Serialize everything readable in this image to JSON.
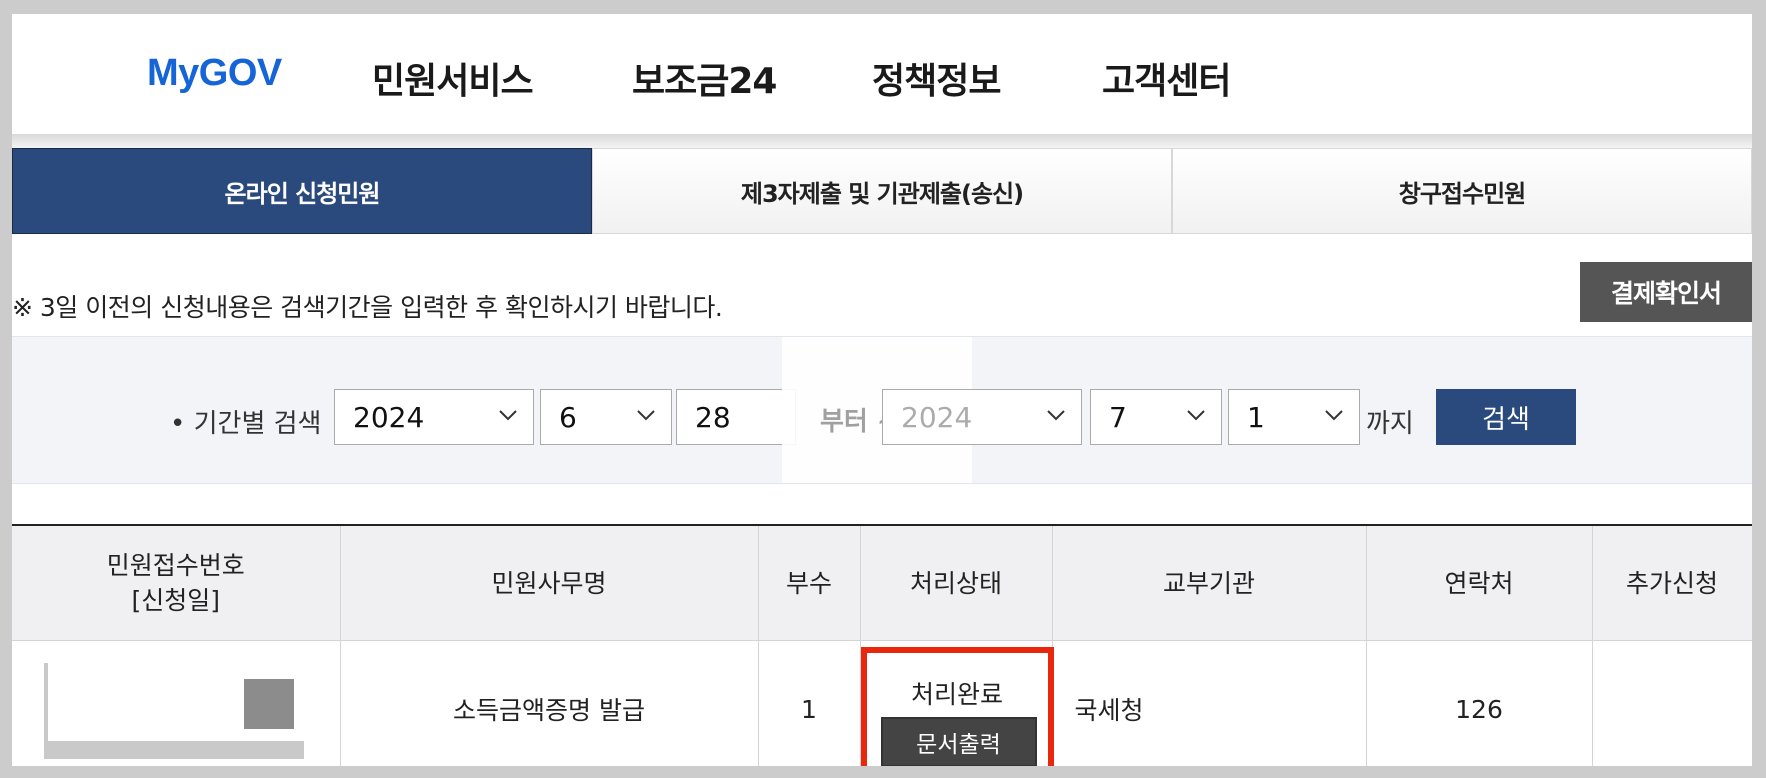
{
  "nav": {
    "logo": "MyGOV",
    "items": [
      "민원서비스",
      "보조금24",
      "정책정보",
      "고객센터"
    ]
  },
  "tabs": [
    "온라인 신청민원",
    "제3자제출 및 기관제출(송신)",
    "창구접수민원"
  ],
  "notice": "※ 3일 이전의 신청내용은 검색기간을 입력한 후 확인하시기 바랍니다.",
  "receipt_button": "결제확인서",
  "search": {
    "label": "• 기간별 검색",
    "start": {
      "year": "2024",
      "month": "6",
      "day": "28"
    },
    "from_text": "부터 ~",
    "end": {
      "year": "2024",
      "month": "7",
      "day": "1"
    },
    "until_text": "까지",
    "button": "검색"
  },
  "table": {
    "headers": [
      "민원접수번호\n[신청일]",
      "민원사무명",
      "부수",
      "처리상태",
      "교부기관",
      "연락처",
      "추가신청"
    ],
    "header_receipt_line1": "민원접수번호",
    "header_receipt_line2": "[신청일]",
    "rows": [
      {
        "service": "소득금액증명 발급",
        "copies": "1",
        "status": "처리완료",
        "print_button": "문서출력",
        "agency": "국세청",
        "contact": "126",
        "extra": ""
      }
    ]
  },
  "colors": {
    "accent": "#2a4a7d",
    "logo": "#1565d8",
    "highlight": "#e8270c"
  }
}
